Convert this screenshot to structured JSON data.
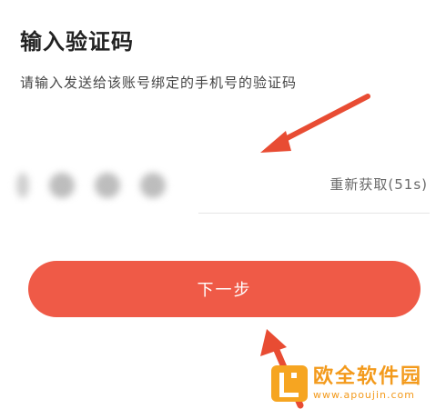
{
  "header": {
    "title": "输入验证码",
    "subtitle": "请输入发送给该账号绑定的手机号的验证码"
  },
  "code_input": {
    "resend_label": "重新获取(51s)"
  },
  "actions": {
    "next_label": "下一步"
  },
  "watermark": {
    "name": "欧全软件园",
    "url": "www.apoujin.com"
  },
  "colors": {
    "accent": "#ef5a47",
    "annotation_arrow": "#e84c33",
    "watermark": "#f39a1c"
  }
}
